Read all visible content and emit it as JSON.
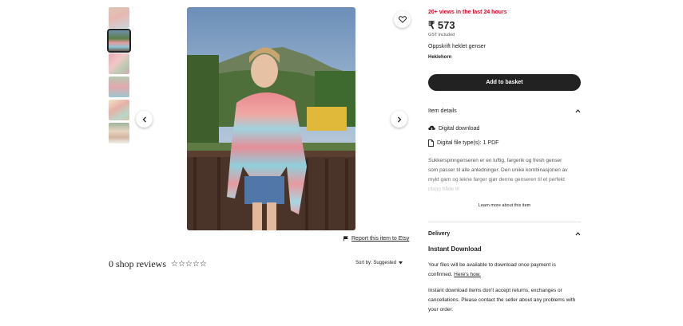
{
  "gallery": {
    "thumbnails": [
      {
        "alt": "thumbnail-1"
      },
      {
        "alt": "thumbnail-2"
      },
      {
        "alt": "thumbnail-3"
      },
      {
        "alt": "thumbnail-4"
      },
      {
        "alt": "thumbnail-5"
      },
      {
        "alt": "thumbnail-6"
      }
    ],
    "report_label": "Report this item to Etsy"
  },
  "reviews": {
    "title": "0 shop reviews",
    "stars": "☆☆☆☆☆",
    "sort_label": "Sort by: Suggested"
  },
  "product": {
    "views": "20+ views in the last 24 hours",
    "price": "₹ 573",
    "gst": "GST included",
    "title": "Oppskrift heklet genser",
    "shop": "Heklehorn",
    "add_to_basket": "Add to basket"
  },
  "item_details": {
    "heading": "Item details",
    "features": [
      "Digital download",
      "Digital file type(s): 1 PDF"
    ],
    "description": "Sukkerspinngenseren er en luftig, fargerik og fresh genser som passer til alle anledninger. Den unike kombinasjonen av mykt garn og lekne farger gjør denne genseren til et perfekt plagg både til",
    "learn_more": "Learn more about this item"
  },
  "delivery": {
    "heading": "Delivery",
    "instant_title": "Instant Download",
    "para1_text": "Your files will be available to download once payment is confirmed.",
    "para1_link": "Here's how.",
    "para2": "Instant download items don't accept returns, exchanges or cancellations. Please contact the seller about any problems with your order."
  },
  "colors": {
    "accent_red": "#c8102e",
    "button_dark": "#222222"
  }
}
